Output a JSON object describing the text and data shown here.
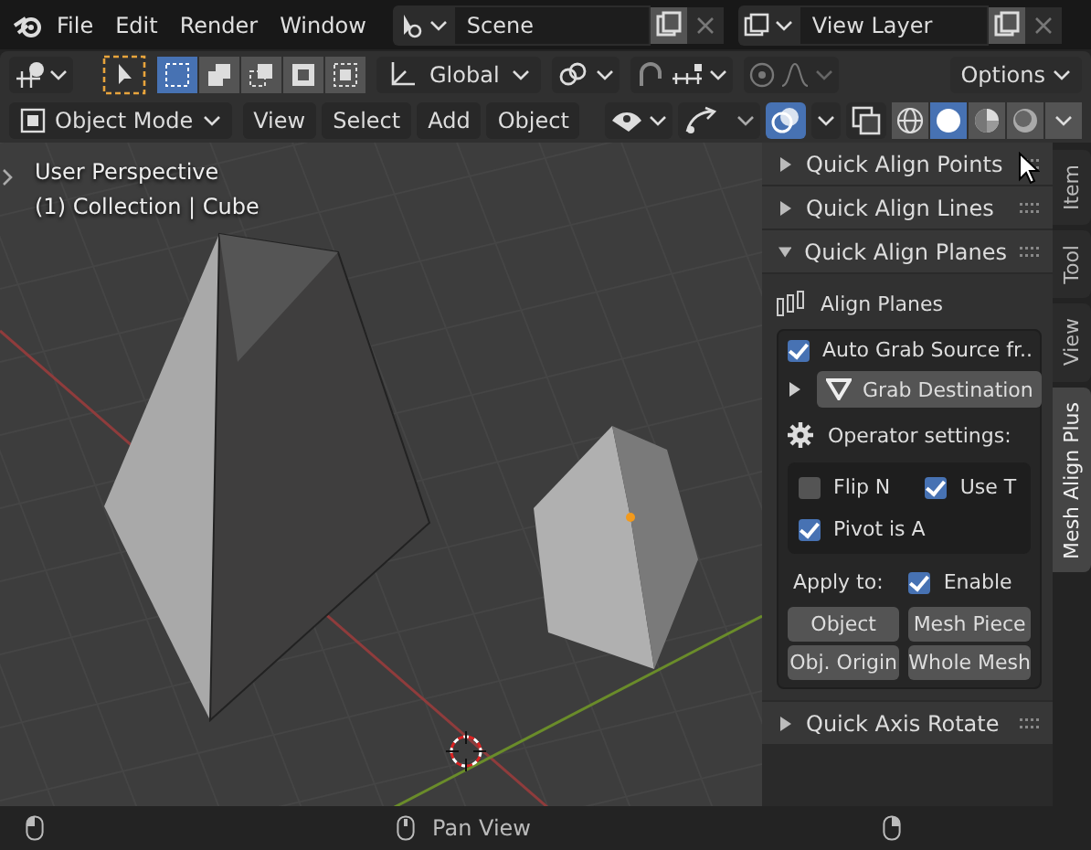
{
  "menu": [
    "File",
    "Edit",
    "Render",
    "Window"
  ],
  "scene": {
    "value": "Scene"
  },
  "view_layer": {
    "value": "View Layer"
  },
  "toolbar": {
    "select_modes": [
      {
        "kind": "new",
        "selected": true
      },
      {
        "kind": "extend",
        "selected": false
      },
      {
        "kind": "subtract",
        "selected": false
      },
      {
        "kind": "invert",
        "selected": false
      },
      {
        "kind": "intersect",
        "selected": false
      }
    ],
    "orientation": "Global",
    "options": "Options"
  },
  "header": {
    "mode": "Object Mode",
    "menus": [
      "View",
      "Select",
      "Add",
      "Object"
    ],
    "xray": {
      "selected": false
    },
    "overlays": {
      "selected": true
    },
    "shading": [
      {
        "kind": "wireframe",
        "selected": false
      },
      {
        "kind": "solid",
        "selected": true
      },
      {
        "kind": "material",
        "selected": false
      },
      {
        "kind": "rendered",
        "selected": false
      }
    ]
  },
  "viewport": {
    "view_name": "User Perspective",
    "collection": "(1) Collection | Cube"
  },
  "sidebar": {
    "panels_top": [
      {
        "title": "Quick Align Points",
        "expanded": false
      },
      {
        "title": "Quick Align Lines",
        "expanded": false
      },
      {
        "title": "Quick Align Planes",
        "expanded": true
      }
    ],
    "content": {
      "heading": "Align Planes",
      "auto_grab": {
        "label": "Auto Grab Source fr..",
        "checked": true
      },
      "grab_destination": {
        "label": "Grab Destination",
        "expanded": false
      },
      "operator_settings": "Operator settings:",
      "options": [
        {
          "label": "Flip N",
          "checked": false
        },
        {
          "label": "Use T",
          "checked": true
        },
        {
          "label": "Pivot is A",
          "checked": true
        }
      ],
      "apply_to": "Apply to:",
      "enable": {
        "label": "Enable",
        "checked": true
      },
      "buttons": [
        "Object",
        "Mesh Piece",
        "Obj. Origin",
        "Whole Mesh"
      ]
    },
    "panels_bottom": [
      {
        "title": "Quick Axis Rotate",
        "expanded": false
      }
    ],
    "tabs": [
      {
        "label": "Item",
        "selected": false
      },
      {
        "label": "Tool",
        "selected": false
      },
      {
        "label": "View",
        "selected": false
      },
      {
        "label": "Mesh Align Plus",
        "selected": true
      }
    ]
  },
  "status_bar": {
    "middle": "Pan View"
  }
}
